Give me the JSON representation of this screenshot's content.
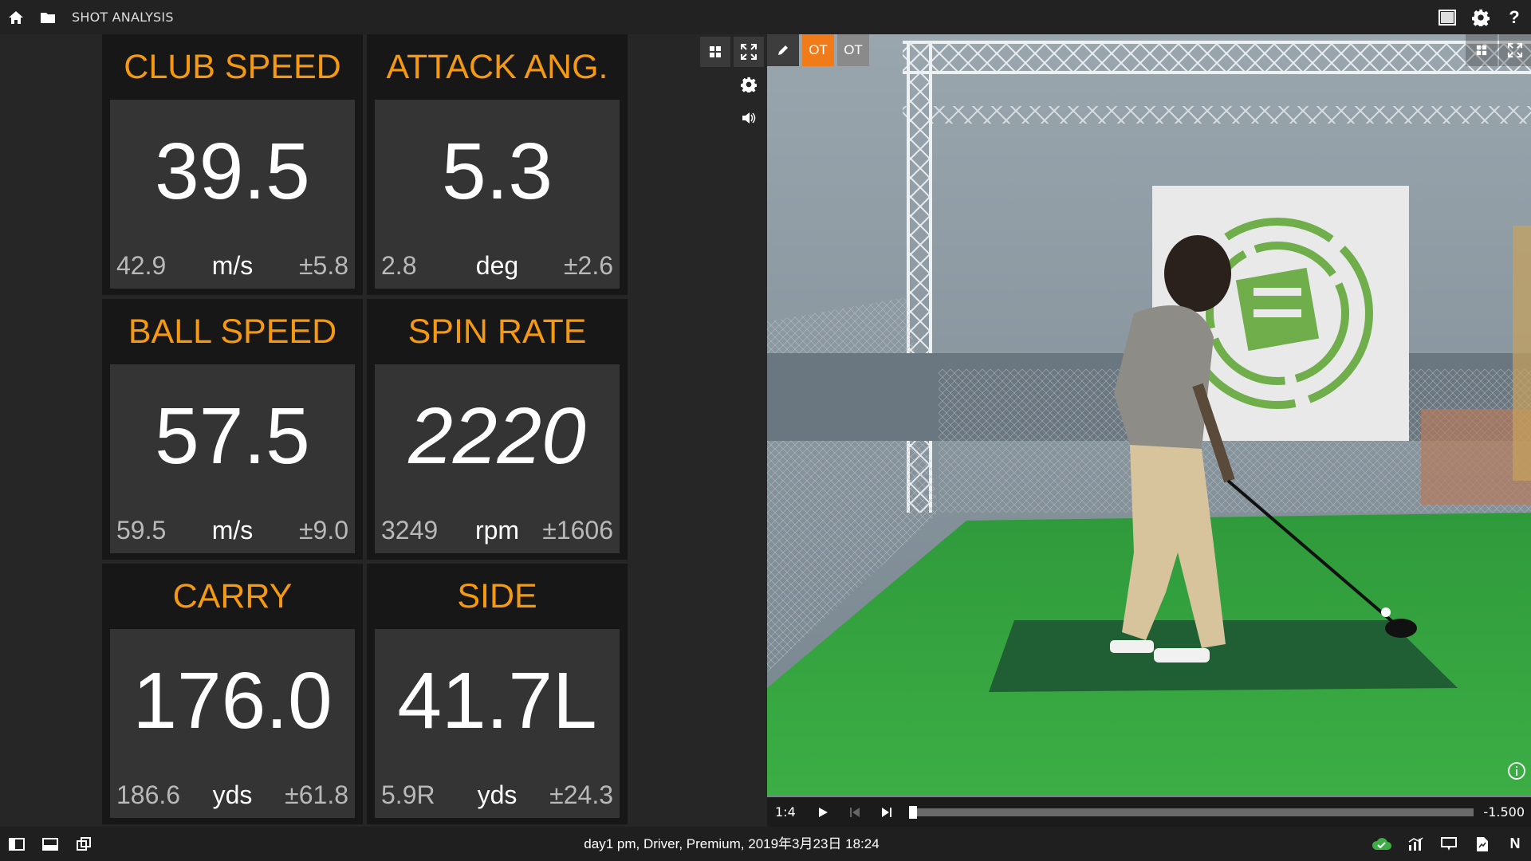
{
  "topbar": {
    "title": "SHOT ANALYSIS",
    "icons": [
      "home-icon",
      "folder-icon",
      "window-icon",
      "gear-icon",
      "help-icon"
    ],
    "help_glyph": "?"
  },
  "tiles": [
    {
      "title": "CLUB SPEED",
      "value": "39.5",
      "avg": "42.9",
      "unit": "m/s",
      "dev": "±5.8"
    },
    {
      "title": "ATTACK ANG.",
      "value": "5.3",
      "avg": "2.8",
      "unit": "deg",
      "dev": "±2.6"
    },
    {
      "title": "BALL SPEED",
      "value": "57.5",
      "avg": "59.5",
      "unit": "m/s",
      "dev": "±9.0"
    },
    {
      "title": "SPIN RATE",
      "value": "2220",
      "avg": "3249",
      "unit": "rpm",
      "dev": "±1606"
    },
    {
      "title": "CARRY",
      "value": "176.0",
      "avg": "186.6",
      "unit": "yds",
      "dev": "±61.8"
    },
    {
      "title": "SIDE",
      "value": "41.7L",
      "avg": "5.9R",
      "unit": "yds",
      "dev": "±24.3"
    }
  ],
  "video": {
    "tool_1": "OT",
    "tool_2": "OT",
    "speed": "1:4",
    "time": "-1.500",
    "colors": {
      "turf": "#2f9a3b",
      "mat": "#1f5f33",
      "banner_logo": "#6fae4a",
      "accent": "#f07b18"
    }
  },
  "bottombar": {
    "session": "day1 pm, Driver, Premium, 2019年3月23日 18:24",
    "right_letter": "N"
  }
}
